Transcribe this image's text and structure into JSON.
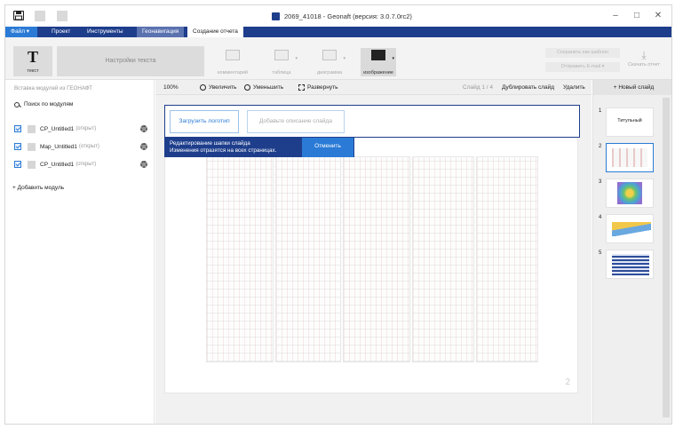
{
  "titlebar": {
    "title": "2069_41018  -  Geonaft (версия: 3.0.7.0rc2)",
    "icons": [
      "save-icon",
      "app-icon"
    ],
    "window_controls": [
      "minimize-icon",
      "maximize-icon",
      "close-icon"
    ]
  },
  "menu": {
    "file": "Файл",
    "items": [
      "Проект",
      "Инструменты",
      "Геонавигация",
      "Создание отчета"
    ],
    "active": "Создание отчета",
    "accent": "#1e3e8c"
  },
  "ribbon": {
    "text_glyph": "T",
    "text_label": "текст",
    "settings_label": "Настройки текста",
    "tools": [
      {
        "label": "комментарий",
        "icon": "comment-icon"
      },
      {
        "label": "таблица",
        "icon": "table-icon"
      },
      {
        "label": "диаграмма",
        "icon": "chart-icon"
      },
      {
        "label": "изображение",
        "icon": "image-icon"
      }
    ],
    "save_template": "Сохранить как шаблон",
    "send_email": "Отправить E-mail",
    "download_report": "Скачать отчет"
  },
  "left_panel": {
    "caption": "Вставка модулей из ГЕОНАФТ",
    "search_label": "Поиск по модулям",
    "modules": [
      {
        "name": "CP_Untitled1",
        "state": "(открыт)",
        "checked": true
      },
      {
        "name": "Map_Untitled1",
        "state": "(открыт)",
        "checked": true
      },
      {
        "name": "CP_Untitled1",
        "state": "(открыт)",
        "checked": true
      }
    ],
    "add_module": "+ Добавить модуль"
  },
  "toolbar": {
    "zoom": "100%",
    "zoom_in": "Увеличить",
    "zoom_out": "Уменьшить",
    "expand": "Развернуть",
    "slide_counter": "Слайд 1 / 4",
    "duplicate": "Дублировать слайд",
    "delete": "Удалить"
  },
  "slide": {
    "upload_logo": "Загрузить логотип",
    "description_placeholder": "Добавьте описание слайда",
    "banner_line1": "Редактирование шапки слайда",
    "banner_line2": "Изменения отразятся на всех страницах.",
    "cancel": "Отменить",
    "page_number": "2"
  },
  "right_panel": {
    "new_slide": "+ Новый слайд",
    "thumbnails": [
      {
        "num": "1",
        "title": "Титульный"
      },
      {
        "num": "2",
        "title": ""
      },
      {
        "num": "3",
        "title": ""
      },
      {
        "num": "4",
        "title": ""
      },
      {
        "num": "5",
        "title": ""
      }
    ],
    "selected": "2"
  }
}
